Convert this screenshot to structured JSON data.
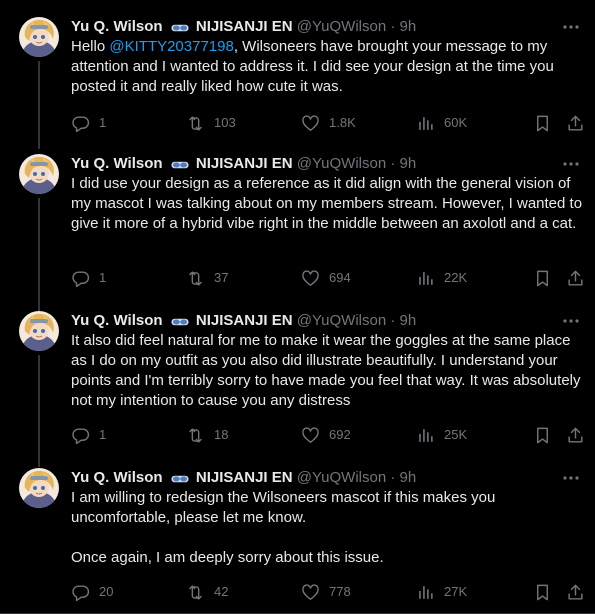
{
  "colors": {
    "background": "#000000",
    "text": "#e7e9ea",
    "secondary": "#71767b",
    "mention": "#1d9bf0",
    "divider": "#2f3336"
  },
  "tweets": [
    {
      "name": "Yu Q. Wilson",
      "affiliation": "NIJISANJI EN",
      "handle": "@YuQWilson",
      "dot": "·",
      "time": "9h",
      "text_before_mention": "Hello ",
      "mention": "@KITTY20377198",
      "text_after_mention": ", Wilsoneers have brought your message to my attention and I wanted to address it. I did see your design at the time you posted it and really liked how cute it was.",
      "replies": "1",
      "retweets": "103",
      "likes": "1.8K",
      "views": "60K"
    },
    {
      "name": "Yu Q. Wilson",
      "affiliation": "NIJISANJI EN",
      "handle": "@YuQWilson",
      "dot": "·",
      "time": "9h",
      "text": "I did use your design as a reference as it did align with the general vision of my mascot I was talking about on my members stream. However, I wanted to give it more of a hybrid vibe right in the middle between an axolotl and a cat.",
      "replies": "1",
      "retweets": "37",
      "likes": "694",
      "views": "22K"
    },
    {
      "name": "Yu Q. Wilson",
      "affiliation": "NIJISANJI EN",
      "handle": "@YuQWilson",
      "dot": "·",
      "time": "9h",
      "text": "It also did feel natural for me to make it wear the goggles at the same place as I do on my outfit as you also did illustrate beautifully. I understand your points and I'm terribly sorry to have made you feel that way. It was absolutely not my intention to cause you any distress",
      "replies": "1",
      "retweets": "18",
      "likes": "692",
      "views": "25K"
    },
    {
      "name": "Yu Q. Wilson",
      "affiliation": "NIJISANJI EN",
      "handle": "@YuQWilson",
      "dot": "·",
      "time": "9h",
      "text_p1": "I am willing to redesign the Wilsoneers mascot if this makes you uncomfortable, please let me know.",
      "text_p2": "Once again, I am deeply sorry about this issue.",
      "replies": "20",
      "retweets": "42",
      "likes": "778",
      "views": "27K"
    }
  ]
}
